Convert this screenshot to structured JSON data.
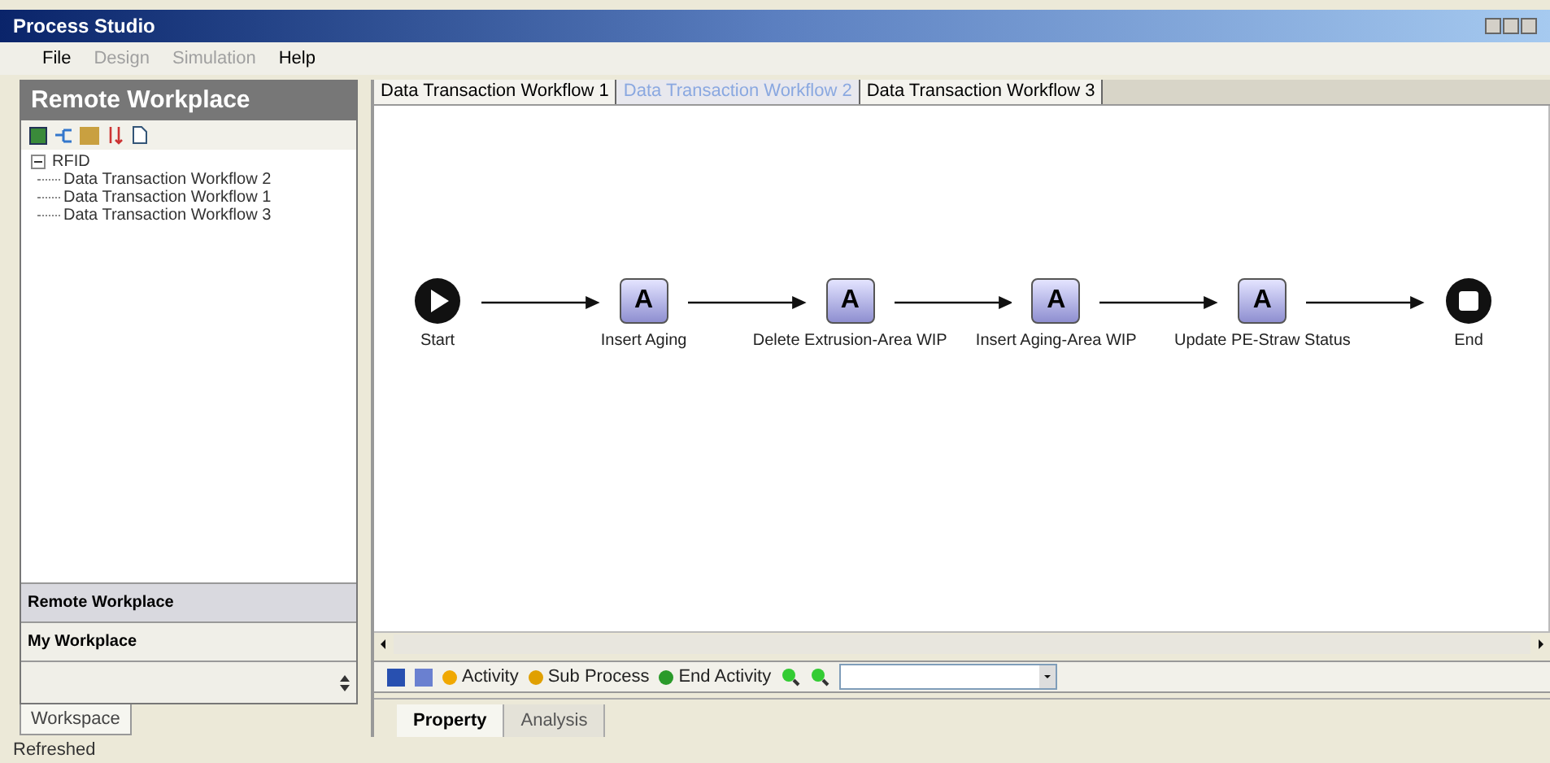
{
  "window": {
    "title": "Process Studio"
  },
  "menu": [
    {
      "label": "File",
      "disabled": false
    },
    {
      "label": "Design",
      "disabled": true
    },
    {
      "label": "Simulation",
      "disabled": true
    },
    {
      "label": "Help",
      "disabled": false
    }
  ],
  "sidebar": {
    "title": "Remote Workplace",
    "tree": [
      {
        "label": "RFID",
        "expanded": true,
        "children": [
          {
            "label": "Data Transaction Workflow 2"
          },
          {
            "label": "Data Transaction Workflow 1"
          },
          {
            "label": "Data Transaction Workflow 3"
          }
        ]
      }
    ],
    "sections": [
      {
        "label": "Remote Workplace",
        "selected": true
      },
      {
        "label": "My Workplace",
        "selected": false
      }
    ],
    "tab": "Workspace"
  },
  "tabs": [
    {
      "label": "Data Transaction Workflow 1",
      "selected": false
    },
    {
      "label": "Data Transaction Workflow 2",
      "selected": true
    },
    {
      "label": "Data Transaction Workflow 3",
      "selected": false
    }
  ],
  "workflow": [
    {
      "kind": "start",
      "label": "Start"
    },
    {
      "kind": "activity",
      "glyph": "A",
      "label": "Insert Aging"
    },
    {
      "kind": "activity",
      "glyph": "A",
      "label": "Delete Extrusion-Area WIP"
    },
    {
      "kind": "activity",
      "glyph": "A",
      "label": "Insert Aging-Area WIP"
    },
    {
      "kind": "activity",
      "glyph": "A",
      "label": "Update PE-Straw Status"
    },
    {
      "kind": "end",
      "label": "End"
    }
  ],
  "toolbar": [
    {
      "kind": "activity",
      "label": "Activity"
    },
    {
      "kind": "subprocess",
      "label": "Sub Process"
    },
    {
      "kind": "end",
      "label": "End Activity"
    }
  ],
  "bottom_tabs": [
    {
      "label": "Property",
      "selected": true
    },
    {
      "label": "Analysis",
      "selected": false
    }
  ],
  "status_bar": "Refreshed"
}
